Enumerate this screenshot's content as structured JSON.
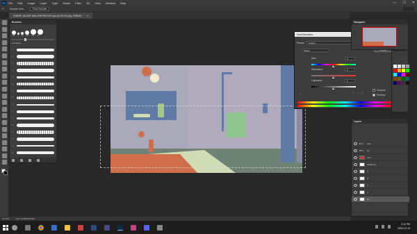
{
  "app": {
    "logo": "Ps",
    "menu": [
      "File",
      "Edit",
      "Image",
      "Layer",
      "Type",
      "Select",
      "Filter",
      "3D",
      "View",
      "Window",
      "Help"
    ],
    "window_controls": [
      "—",
      "☐",
      "✕"
    ]
  },
  "options_bar": {
    "sample_size_label": "Sample Size:",
    "sample_size_value": "Point Sample"
  },
  "document": {
    "tab_title": "CHARK JACKIE WALLPAPER EDIT.psd @ 33.3% (bg, RGB/8) *",
    "tab_close": "×"
  },
  "brushes_panel": {
    "title": "Brushes",
    "tip_sizes": [
      "336",
      "6",
      "10",
      "200",
      "300",
      "64"
    ],
    "folder_label": "▸ brushes",
    "stroke_nums": [
      "12",
      "28",
      "24",
      "40",
      "30",
      "18",
      "20",
      "50",
      "22",
      "36",
      "24",
      "48",
      "30",
      "60",
      "25",
      "18",
      "40",
      "44"
    ]
  },
  "hue_saturation": {
    "title": "Hue/Saturation",
    "close": "✕",
    "preset_label": "Preset:",
    "preset_value": "Default",
    "ok_label": "OK",
    "cancel_label": "Cancel",
    "channel_value": "Master",
    "hue_label": "Hue:",
    "hue_value": "0",
    "saturation_label": "Saturation:",
    "saturation_value": "0",
    "lightness_label": "Lightness:",
    "lightness_value": "0",
    "colorize_label": "Colorize",
    "preview_label": "Preview",
    "colorize_checked": false,
    "preview_checked": true
  },
  "panels": {
    "navigator_title": "Navigator",
    "layers_title": "Layers"
  },
  "layers": [
    {
      "name": "seat",
      "type": "folder",
      "selected": false
    },
    {
      "name": "bg",
      "type": "folder",
      "selected": false
    },
    {
      "name": "ref it",
      "type": "layer",
      "thumb": "red",
      "selected": false
    },
    {
      "name": "details bg",
      "type": "layer",
      "thumb": "white",
      "selected": false
    },
    {
      "name": "4",
      "type": "layer",
      "thumb": "white",
      "selected": false
    },
    {
      "name": "3",
      "type": "layer",
      "thumb": "white",
      "selected": false
    },
    {
      "name": "2",
      "type": "layer",
      "thumb": "white",
      "selected": false
    },
    {
      "name": "1",
      "type": "layer",
      "thumb": "white",
      "selected": false
    },
    {
      "name": "bg",
      "type": "layer",
      "thumb": "white",
      "selected": true
    }
  ],
  "status_bar": {
    "zoom": "33.33%",
    "doc_size": "Doc: 5.93M/100.3M"
  },
  "taskbar": {
    "time": "2:11 PM",
    "date": "2022-12-13"
  },
  "colors": {
    "accent": "#31a8ff",
    "swatches": [
      "#ffffff",
      "#e6e6e6",
      "#cccccc",
      "#999999",
      "#ff0000",
      "#ffaa00",
      "#ffff00",
      "#00ff00",
      "#00ffff",
      "#0000ff",
      "#ff00ff",
      "#660000",
      "#884400",
      "#666600",
      "#006600",
      "#006666",
      "#000066",
      "#660066",
      "#333333",
      "#111111"
    ]
  }
}
